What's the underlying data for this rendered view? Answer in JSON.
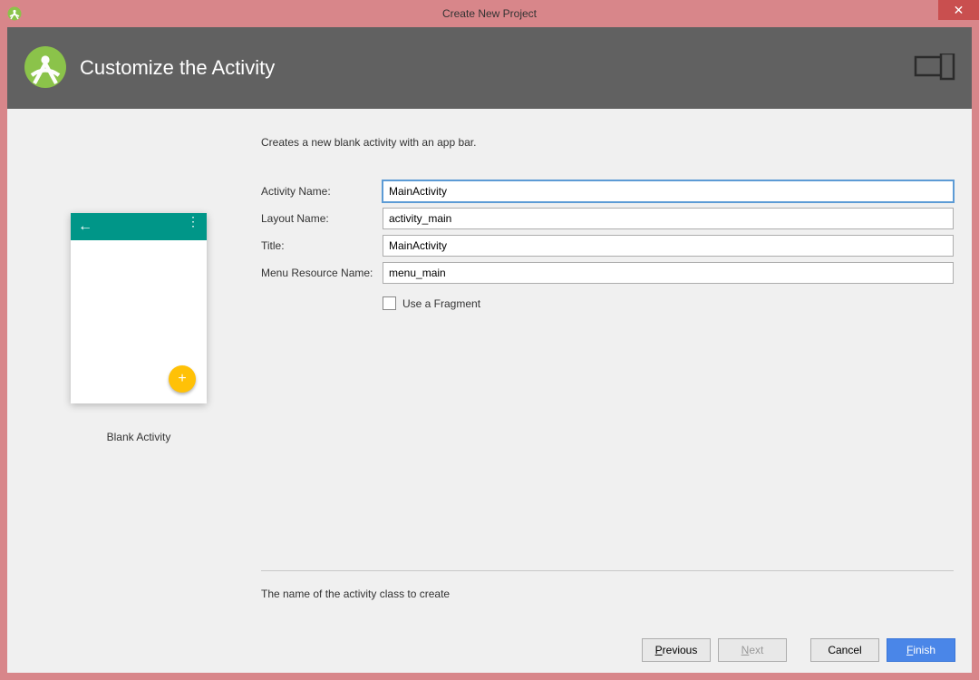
{
  "window": {
    "title": "Create New Project"
  },
  "header": {
    "title": "Customize the Activity"
  },
  "preview": {
    "label": "Blank Activity"
  },
  "form": {
    "description": "Creates a new blank activity with an app bar.",
    "activityName": {
      "label": "Activity Name:",
      "value": "MainActivity"
    },
    "layoutName": {
      "label": "Layout Name:",
      "value": "activity_main"
    },
    "title": {
      "label": "Title:",
      "value": "MainActivity"
    },
    "menuResource": {
      "label": "Menu Resource Name:",
      "value": "menu_main"
    },
    "useFragment": {
      "label": "Use a Fragment",
      "checked": false
    },
    "hint": "The name of the activity class to create"
  },
  "buttons": {
    "previous": "Previous",
    "next": "Next",
    "cancel": "Cancel",
    "finish": "Finish"
  }
}
